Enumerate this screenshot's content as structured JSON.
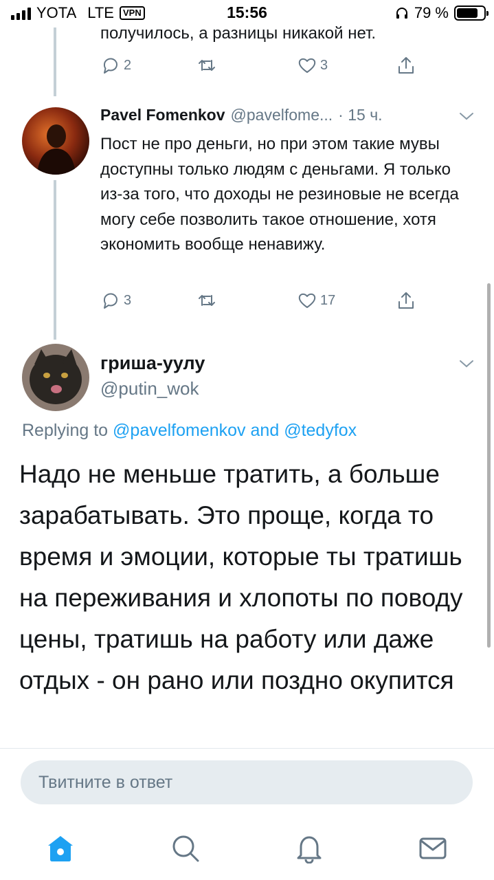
{
  "status_bar": {
    "carrier": "YOTA",
    "network": "LTE",
    "vpn": "VPN",
    "time": "15:56",
    "battery_percent": "79 %",
    "battery_level": 0.79
  },
  "previous_tweet": {
    "text_tail": "получилось, а разницы никакой нет.",
    "replies": "2",
    "retweets": "",
    "likes": "3"
  },
  "tweet_pavel": {
    "name": "Pavel Fomenkov",
    "handle": "@pavelfome...",
    "time": "· 15 ч.",
    "text": "Пост не про деньги, но при этом такие мувы доступны только людям с деньгами. Я только из-за того, что доходы не резиновые не всегда могу себе позволить такое отношение, хотя экономить вообще ненавижу.",
    "replies": "3",
    "retweets": "",
    "likes": "17"
  },
  "main_tweet": {
    "name": "гриша-уулу",
    "handle": "@putin_wok",
    "replying_prefix": "Replying to",
    "replying_user1": "@pavelfomenkov",
    "replying_and": "and",
    "replying_user2": "@tedyfox",
    "text": "Надо не меньше тратить, а больше зарабатывать. Это проще, когда то время и эмоции, которые ты тратишь на переживания и хлопоты по поводу цены, тратишь на работу или даже отдых - он рано или поздно окупится"
  },
  "reply_box": {
    "placeholder": "Твитните в ответ"
  },
  "tab_bar": {
    "tabs": [
      "home-icon",
      "search-icon",
      "notifications-icon",
      "messages-icon"
    ],
    "active_color": "#1da1f2",
    "inactive_color": "#657786"
  },
  "colors": {
    "accent": "#1da1f2",
    "secondary_text": "#657786"
  }
}
